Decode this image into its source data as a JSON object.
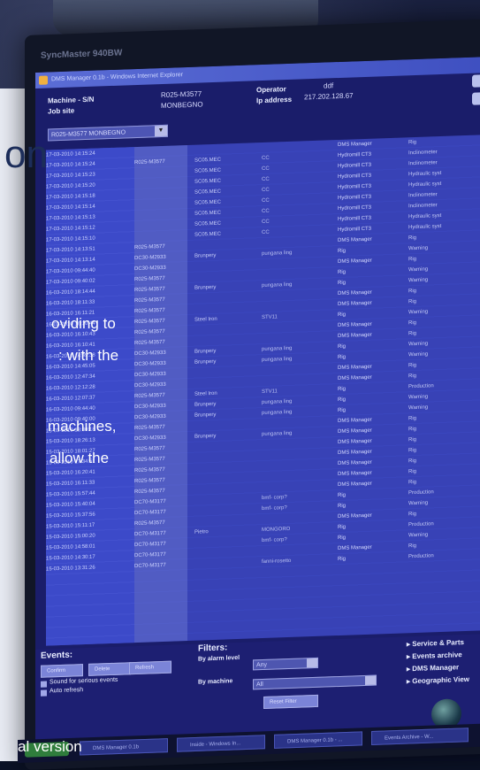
{
  "monitor": {
    "brand_label": "SyncMaster 940BW"
  },
  "window": {
    "title": "DMS Manager 0.1b - Windows Internet Explorer"
  },
  "header": {
    "machine_label": "Machine - S/N",
    "machine_value": "R025-M3577",
    "job_label": "Job site",
    "job_value": "MONBEGNO",
    "operator_label": "Operator",
    "operator_value": "ddf",
    "ip_label": "Ip address",
    "ip_value": "217.202.128.67",
    "combo_value": "R025-M3577 MONBEGNO"
  },
  "rows": [
    {
      "date": "17-03-2010 14:15:24",
      "id": "",
      "state": "",
      "model": "",
      "src": "DMS Manager",
      "type": "Rig"
    },
    {
      "date": "17-03-2010 14:15:24",
      "id": "R025-M3577",
      "state": "SC05.MEC",
      "model": "CC",
      "src": "Hydromill CT3",
      "type": "Inclinometer"
    },
    {
      "date": "17-03-2010 14:15:23",
      "id": "",
      "state": "SC05.MEC",
      "model": "CC",
      "src": "Hydromill CT3",
      "type": "Inclinometer"
    },
    {
      "date": "17-03-2010 14:15:20",
      "id": "",
      "state": "SC05.MEC",
      "model": "CC",
      "src": "Hydromill CT3",
      "type": "Hydraulic syst"
    },
    {
      "date": "17-03-2010 14:15:18",
      "id": "",
      "state": "SC05.MEC",
      "model": "CC",
      "src": "Hydromill CT3",
      "type": "Hydraulic syst"
    },
    {
      "date": "17-03-2010 14:15:14",
      "id": "",
      "state": "SC05.MEC",
      "model": "CC",
      "src": "Hydromill CT3",
      "type": "Inclinometer"
    },
    {
      "date": "17-03-2010 14:15:13",
      "id": "",
      "state": "SC05.MEC",
      "model": "CC",
      "src": "Hydromill CT3",
      "type": "Inclinometer"
    },
    {
      "date": "17-03-2010 14:15:12",
      "id": "",
      "state": "SC05.MEC",
      "model": "CC",
      "src": "Hydromill CT3",
      "type": "Hydraulic syst"
    },
    {
      "date": "17-03-2010 14:15:10",
      "id": "",
      "state": "SC05.MEC",
      "model": "CC",
      "src": "Hydromill CT3",
      "type": "Hydraulic syst"
    },
    {
      "date": "17-03-2010 14:13:51",
      "id": "R025-M3577",
      "state": "",
      "model": "",
      "src": "DMS Manager",
      "type": "Rig"
    },
    {
      "date": "17-03-2010 14:13:14",
      "id": "DC30-M2933",
      "state": "Brunpery",
      "model": "pungana ling",
      "src": "Rig",
      "type": "Warning"
    },
    {
      "date": "17-03-2010 09:44:40",
      "id": "DC30-M2933",
      "state": "",
      "model": "",
      "src": "DMS Manager",
      "type": "Rig"
    },
    {
      "date": "17-03-2010 09:40:02",
      "id": "R025-M3577",
      "state": "",
      "model": "",
      "src": "Rig",
      "type": "Warning"
    },
    {
      "date": "16-03-2010 18:14:44",
      "id": "R025-M3577",
      "state": "Brunpery",
      "model": "pungana ling",
      "src": "Rig",
      "type": "Warning"
    },
    {
      "date": "16-03-2010 18:11:33",
      "id": "R025-M3577",
      "state": "",
      "model": "",
      "src": "DMS Manager",
      "type": "Rig"
    },
    {
      "date": "16-03-2010 16:11:21",
      "id": "R025-M3577",
      "state": "",
      "model": "",
      "src": "DMS Manager",
      "type": "Rig"
    },
    {
      "date": "16-03-2010 16:10:44",
      "id": "R025-M3577",
      "state": "Steel Iron",
      "model": "STV11",
      "src": "Rig",
      "type": "Warning"
    },
    {
      "date": "16-03-2010 16:10:43",
      "id": "R025-M3577",
      "state": "",
      "model": "",
      "src": "DMS Manager",
      "type": "Rig"
    },
    {
      "date": "16-03-2010 16:10:41",
      "id": "R025-M3577",
      "state": "",
      "model": "",
      "src": "DMS Manager",
      "type": "Rig"
    },
    {
      "date": "16-03-2010 14:49:38",
      "id": "DC30-M2933",
      "state": "Brunpery",
      "model": "pungana ling",
      "src": "Rig",
      "type": "Warning"
    },
    {
      "date": "16-03-2010 14:45:05",
      "id": "DC30-M2933",
      "state": "Brunpery",
      "model": "pungana ling",
      "src": "Rig",
      "type": "Warning"
    },
    {
      "date": "16-03-2010 12:47:34",
      "id": "DC30-M2933",
      "state": "",
      "model": "",
      "src": "DMS Manager",
      "type": "Rig"
    },
    {
      "date": "16-03-2010 12:12:28",
      "id": "DC30-M2933",
      "state": "",
      "model": "",
      "src": "DMS Manager",
      "type": "Rig"
    },
    {
      "date": "16-03-2010 12:07:37",
      "id": "R025-M3577",
      "state": "Steel Iron",
      "model": "STV11",
      "src": "Rig",
      "type": "Production"
    },
    {
      "date": "16-03-2010 09:44:40",
      "id": "DC30-M2933",
      "state": "Brunpery",
      "model": "pungana ling",
      "src": "Rig",
      "type": "Warning"
    },
    {
      "date": "16-03-2010 09:40:00",
      "id": "DC30-M2933",
      "state": "Brunpery",
      "model": "pungana ling",
      "src": "Rig",
      "type": "Warning"
    },
    {
      "date": "15-03-2010 18:30:18",
      "id": "R025-M3577",
      "state": "",
      "model": "",
      "src": "DMS Manager",
      "type": "Rig"
    },
    {
      "date": "15-03-2010 18:26:13",
      "id": "DC30-M2933",
      "state": "Brunpery",
      "model": "pungana ling",
      "src": "DMS Manager",
      "type": "Rig"
    },
    {
      "date": "15-03-2010 18:01:27",
      "id": "R025-M3577",
      "state": "",
      "model": "",
      "src": "DMS Manager",
      "type": "Rig"
    },
    {
      "date": "15-03-2010 17:34:51",
      "id": "R025-M3577",
      "state": "",
      "model": "",
      "src": "DMS Manager",
      "type": "Rig"
    },
    {
      "date": "15-03-2010 16:20:41",
      "id": "R025-M3577",
      "state": "",
      "model": "",
      "src": "DMS Manager",
      "type": "Rig"
    },
    {
      "date": "15-03-2010 16:11:33",
      "id": "R025-M3577",
      "state": "",
      "model": "",
      "src": "DMS Manager",
      "type": "Rig"
    },
    {
      "date": "15-03-2010 15:57:44",
      "id": "R025-M3577",
      "state": "",
      "model": "",
      "src": "DMS Manager",
      "type": "Rig"
    },
    {
      "date": "15-03-2010 15:40:04",
      "id": "DC70-M3177",
      "state": "",
      "model": "bmf- corp?",
      "src": "Rig",
      "type": "Production"
    },
    {
      "date": "15-03-2010 15:37:56",
      "id": "DC70-M3177",
      "state": "",
      "model": "bmf- corp?",
      "src": "Rig",
      "type": "Warning"
    },
    {
      "date": "15-03-2010 15:11:17",
      "id": "R025-M3577",
      "state": "",
      "model": "",
      "src": "DMS Manager",
      "type": "Rig"
    },
    {
      "date": "15-03-2010 15:00:20",
      "id": "DC70-M3177",
      "state": "Pietro",
      "model": "MONGORO",
      "src": "Rig",
      "type": "Production"
    },
    {
      "date": "15-03-2010 14:58:01",
      "id": "DC70-M3177",
      "state": "",
      "model": "bmf- corp?",
      "src": "Rig",
      "type": "Warning"
    },
    {
      "date": "15-03-2010 14:30:17",
      "id": "DC70-M3177",
      "state": "",
      "model": "",
      "src": "DMS Manager",
      "type": "Rig"
    },
    {
      "date": "15-03-2010 13:31:26",
      "id": "DC70-M3177",
      "state": "",
      "model": "fanni-rosetto",
      "src": "Rig",
      "type": "Production"
    }
  ],
  "events": {
    "title": "Events:",
    "btn1": "Confirm",
    "btn2": "Delete",
    "btn3": "Refresh",
    "chk1": "Sound for serious events",
    "chk2": "Auto refresh"
  },
  "filters": {
    "title": "Filters:",
    "by_alarm_level": "By alarm level",
    "alarm_value": "Any",
    "by_machine": "By machine",
    "machine_value": "All",
    "reset": "Reset Filter"
  },
  "links": [
    "Service & Parts",
    "Events archive",
    "DMS Manager",
    "Geographic View"
  ],
  "taskbar": [
    "DMS Manager 0.1b",
    "Inside - Windows In...",
    "DMS Manager 0.1b - ...",
    "Events Archive - W..."
  ],
  "page_text": {
    "big": "on",
    "l1": "oviding to",
    "l2": ": with the",
    "l3": "machines,",
    "l4": "allow the",
    "l5": "al version"
  }
}
